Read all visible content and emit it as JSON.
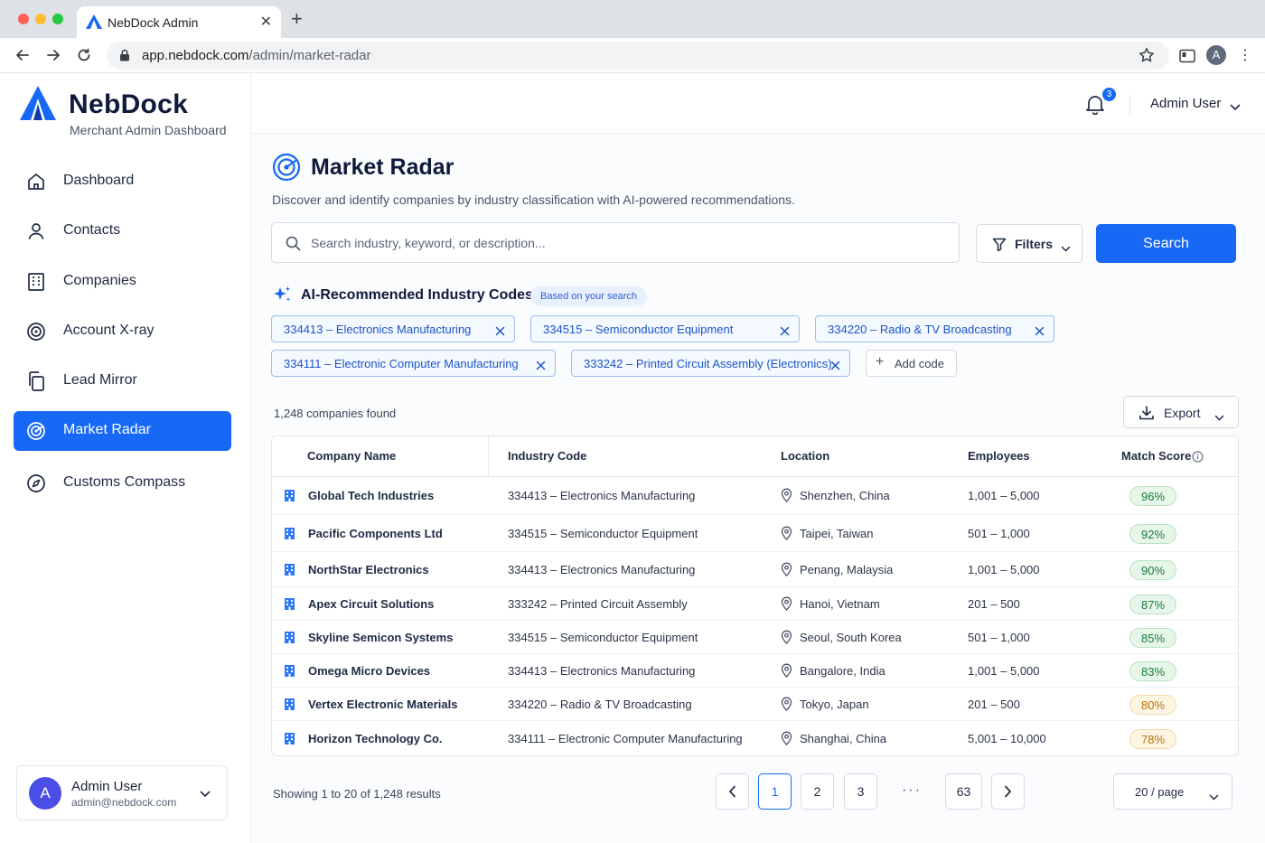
{
  "browser": {
    "tab_title": "NebDock Admin",
    "url_host": "app.nebdock.com",
    "url_path": "/admin/market-radar",
    "profile_initial": "A"
  },
  "brand": {
    "name": "NebDock",
    "subtitle": "Merchant Admin Dashboard"
  },
  "sidebar": {
    "items": [
      {
        "label": "Dashboard",
        "icon": "home-icon"
      },
      {
        "label": "Contacts",
        "icon": "person-icon"
      },
      {
        "label": "Companies",
        "icon": "building-icon"
      },
      {
        "label": "Account X-ray",
        "icon": "target-icon"
      },
      {
        "label": "Lead Mirror",
        "icon": "copy-icon"
      },
      {
        "label": "Market Radar",
        "icon": "radar-icon",
        "active": true
      },
      {
        "label": "Customs Compass",
        "icon": "compass-icon"
      }
    ],
    "user": {
      "initial": "A",
      "name": "Admin User",
      "email": "admin@nebdock.com"
    }
  },
  "header": {
    "notifications_count": "3",
    "user_name": "Admin User"
  },
  "page": {
    "title": "Market Radar",
    "description": "Discover and identify companies by industry classification with AI-powered recommendations."
  },
  "search": {
    "placeholder": "Search industry, keyword, or description...",
    "value": "",
    "filters_label": "Filters",
    "button_label": "Search"
  },
  "ai": {
    "title": "AI-Recommended Industry Codes",
    "badge": "Based on your search",
    "chips": [
      "334413  –  Electronics Manufacturing",
      "334515  –  Semiconductor Equipment",
      "334220  –  Radio & TV Broadcasting",
      "334111  –  Electronic Computer Manufacturing",
      "333242  –  Printed Circuit Assembly (Electronics)"
    ],
    "add_code_label": "Add code"
  },
  "results": {
    "count_text": "1,248 companies found",
    "export_label": "Export"
  },
  "table": {
    "columns": [
      "Company Name",
      "Industry Code",
      "Location",
      "Employees",
      "Match Score"
    ],
    "rows": [
      {
        "company": "Global Tech Industries",
        "industry": "334413  –  Electronics Manufacturing",
        "location": "Shenzhen, China",
        "employees": "1,001 – 5,000",
        "score": "96%",
        "tier": "high"
      },
      {
        "company": "Pacific Components Ltd",
        "industry": "334515  –  Semiconductor Equipment",
        "location": "Taipei, Taiwan",
        "employees": "501 – 1,000",
        "score": "92%",
        "tier": "high"
      },
      {
        "company": "NorthStar Electronics",
        "industry": "334413  –  Electronics Manufacturing",
        "location": "Penang, Malaysia",
        "employees": "1,001 – 5,000",
        "score": "90%",
        "tier": "high"
      },
      {
        "company": "Apex Circuit Solutions",
        "industry": "333242  –  Printed Circuit Assembly",
        "location": "Hanoi, Vietnam",
        "employees": "201 – 500",
        "score": "87%",
        "tier": "high"
      },
      {
        "company": "Skyline Semicon Systems",
        "industry": "334515  –  Semiconductor Equipment",
        "location": "Seoul, South Korea",
        "employees": "501 – 1,000",
        "score": "85%",
        "tier": "high"
      },
      {
        "company": "Omega Micro Devices",
        "industry": "334413  –  Electronics Manufacturing",
        "location": "Bangalore, India",
        "employees": "1,001 – 5,000",
        "score": "83%",
        "tier": "high"
      },
      {
        "company": "Vertex Electronic Materials",
        "industry": "334220  –  Radio & TV Broadcasting",
        "location": "Tokyo, Japan",
        "employees": "201 – 500",
        "score": "80%",
        "tier": "mid"
      },
      {
        "company": "Horizon Technology Co.",
        "industry": "334111  –  Electronic Computer Manufacturing",
        "location": "Shanghai, China",
        "employees": "5,001 – 10,000",
        "score": "78%",
        "tier": "mid"
      }
    ]
  },
  "pagination": {
    "showing_text": "Showing 1 to 20 of 1,248 results",
    "pages": [
      "1",
      "2",
      "3"
    ],
    "ellipsis": "···",
    "last_page": "63",
    "per_page": "20 / page",
    "active_page": "1"
  },
  "colors": {
    "accent": "#1769f5",
    "score_high": "#1c7a39",
    "score_mid": "#b5720b"
  }
}
